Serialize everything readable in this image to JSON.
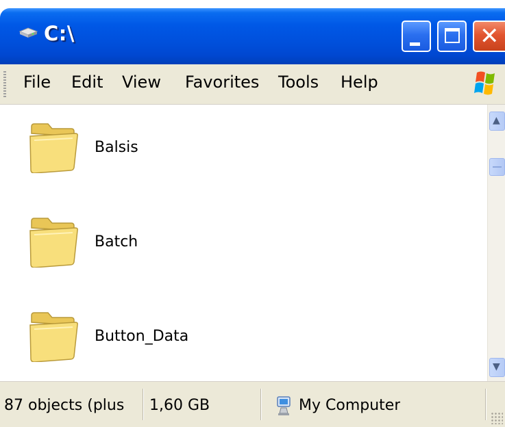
{
  "window": {
    "title": "C:\\",
    "title_icon": "drive-icon",
    "controls": [
      "minimize",
      "maximize",
      "close"
    ]
  },
  "menubar": {
    "items": [
      "File",
      "Edit",
      "View",
      "Favorites",
      "Tools",
      "Help"
    ]
  },
  "folders": [
    {
      "name": "Balsis",
      "icon": "folder-icon"
    },
    {
      "name": "Batch",
      "icon": "folder-icon"
    },
    {
      "name": "Button_Data",
      "icon": "folder-icon"
    }
  ],
  "statusbar": {
    "objects": "87 objects (plus",
    "size": "1,60 GB",
    "location": "My Computer",
    "location_icon": "my-computer-icon"
  },
  "colors": {
    "titlebar": "#0054e3",
    "close_button": "#e25530",
    "chrome": "#ece9d8",
    "folder": "#f6d86a"
  }
}
